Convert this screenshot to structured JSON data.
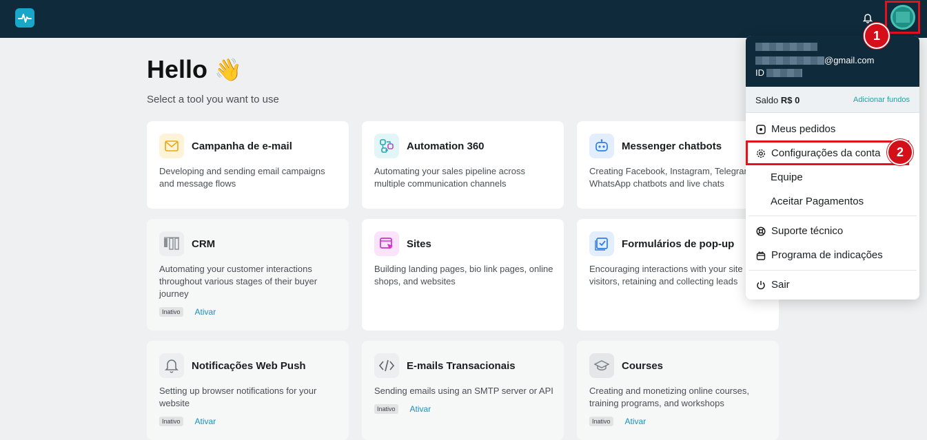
{
  "header": {
    "logo_icon": "pulse-logo-icon",
    "bell_icon": "bell-icon",
    "avatar_icon": "user-avatar"
  },
  "main": {
    "greeting": "Hello",
    "greeting_emoji": "👋",
    "subtitle": "Select a tool you want to use",
    "cards": [
      {
        "title": "Campanha de e-mail",
        "desc": "Developing and sending email campaigns and message flows",
        "icon": "envelope-icon",
        "active": true
      },
      {
        "title": "Automation 360",
        "desc": "Automating your sales pipeline across multiple communication channels",
        "icon": "flow-icon",
        "active": true
      },
      {
        "title": "Messenger chatbots",
        "desc": "Creating Facebook, Instagram, Telegram, WhatsApp chatbots and live chats",
        "icon": "robot-icon",
        "active": true
      },
      {
        "title": "CRM",
        "desc": "Automating your customer interactions throughout various stages of their buyer journey",
        "icon": "kanban-icon",
        "active": false,
        "badge": "Inativo",
        "action": "Ativar"
      },
      {
        "title": "Sites",
        "desc": "Building landing pages, bio link pages, online shops, and websites",
        "icon": "website-cursor-icon",
        "active": true
      },
      {
        "title": "Formulários de pop-up",
        "desc": "Encouraging interactions with your site visitors, retaining and collecting leads",
        "icon": "checkbox-form-icon",
        "active": true
      },
      {
        "title": "Notificações Web Push",
        "desc": "Setting up browser notifications for your website",
        "icon": "bell-push-icon",
        "active": false,
        "badge": "Inativo",
        "action": "Ativar"
      },
      {
        "title": "E-mails Transacionais",
        "desc": "Sending emails using an SMTP server or API",
        "icon": "code-icon",
        "active": false,
        "badge": "Inativo",
        "action": "Ativar"
      },
      {
        "title": "Courses",
        "desc": "Creating and monetizing online courses, training programs, and workshops",
        "icon": "graduation-cap-icon",
        "active": false,
        "badge": "Inativo",
        "action": "Ativar"
      }
    ]
  },
  "account_menu": {
    "email_suffix": "@gmail.com",
    "id_label": "ID",
    "balance_label": "Saldo",
    "balance_value": "R$ 0",
    "add_funds": "Adicionar fundos",
    "items": [
      {
        "label": "Meus pedidos",
        "icon": "orders-icon"
      },
      {
        "label": "Configurações da conta",
        "icon": "gear-icon"
      },
      {
        "label": "Equipe",
        "icon": ""
      },
      {
        "label": "Aceitar Pagamentos",
        "icon": ""
      },
      {
        "label": "Suporte técnico",
        "icon": "lifebuoy-icon"
      },
      {
        "label": "Programa de indicações",
        "icon": "gift-icon"
      },
      {
        "label": "Sair",
        "icon": "power-icon"
      }
    ]
  },
  "annotations": {
    "step1": "1",
    "step2": "2"
  }
}
